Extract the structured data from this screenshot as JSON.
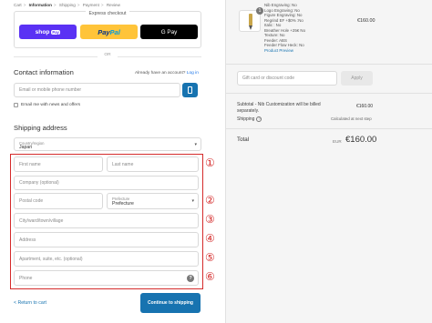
{
  "breadcrumbs": [
    {
      "label": "Cart",
      "current": false
    },
    {
      "label": "Information",
      "current": true
    },
    {
      "label": "Shipping",
      "current": false
    },
    {
      "label": "Payment",
      "current": false
    },
    {
      "label": "Review",
      "current": false
    }
  ],
  "breadcrumb_separator": ">",
  "express": {
    "title": "Express checkout",
    "shop_pay": "shop",
    "shop_pay_pill": "Pay",
    "paypal_a": "Pay",
    "paypal_b": "Pal",
    "gpay": "G Pay"
  },
  "or_label": "OR",
  "contact": {
    "heading": "Contact information",
    "account_prompt": "Already have an account?",
    "login_link": "Log in",
    "email_placeholder": "Email or mobile phone number",
    "newsletter_label": "Email me with news and offers"
  },
  "shipping": {
    "heading": "Shipping address",
    "country_label": "Country/region",
    "country_value": "Japan",
    "first_name": "First name",
    "last_name": "Last name",
    "company": "Company (optional)",
    "postal": "Postal code",
    "prefecture_label": "Prefecture",
    "prefecture_value": "Prefecture",
    "city": "City/ward/town/village",
    "address": "Address",
    "apartment": "Apartment, suite, etc. (optional)",
    "phone": "Phone",
    "phone_help": "?"
  },
  "annotations": [
    "①",
    "②",
    "③",
    "④",
    "⑤",
    "⑥"
  ],
  "footer": {
    "back_link": "< Return to cart",
    "continue_label": "Continue to shipping"
  },
  "summary": {
    "item_quantity": "1",
    "specs": [
      "Nib Engraving: No",
      "Logo Engraving: No",
      "Figure Engraving: No",
      "Regrind EF +$0% :No",
      "Italic : No",
      "Breather Hole +25€ No",
      "Texture: No",
      "Feeder: ABS",
      "Feeder Flow Heck: No"
    ],
    "product_preview": "Product Preview",
    "item_price": "€160.00",
    "gift_placeholder": "Gift card or discount code",
    "apply_label": "Apply",
    "subtotal_label_1": "Subtotal - Nib Customization will be billed",
    "subtotal_label_2": "separately.",
    "subtotal_value": "€160.00",
    "shipping_label": "Shipping",
    "shipping_help": "?",
    "shipping_value": "Calculated at next step",
    "total_label": "Total",
    "currency_code": "EUR",
    "total_value": "€160.00"
  },
  "colors": {
    "accent": "#1773b0",
    "annotation_red": "#d52b2b",
    "shop_pay": "#5a31f4",
    "paypal": "#ffc439",
    "gpay": "#000000",
    "summary_bg": "#f5f5f5"
  },
  "icons": {
    "phone_button": "smartphone-icon",
    "select_chevron": "chevron-down-icon",
    "help": "question-circle-icon"
  }
}
